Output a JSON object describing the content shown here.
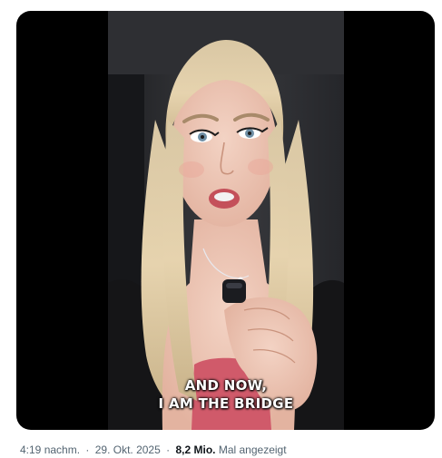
{
  "video": {
    "caption_line1": "AND NOW,",
    "caption_line2": "I AM THE BRIDGE"
  },
  "meta": {
    "time": "4:19 nachm.",
    "separator": "·",
    "date": "29. Okt. 2025",
    "views_count": "8,2 Mio.",
    "views_label": "Mal angezeigt"
  },
  "colors": {
    "meta_text": "#536471",
    "meta_strong": "#0f1419",
    "media_background": "#000000"
  }
}
